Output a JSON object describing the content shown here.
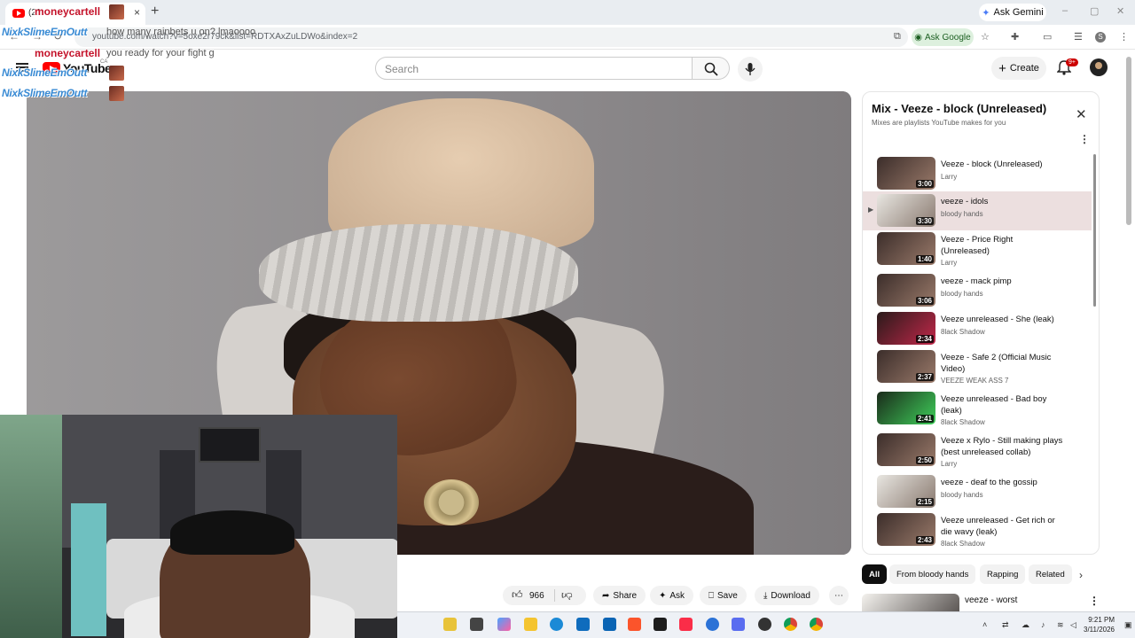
{
  "browser": {
    "tab_count_prefix": "(23",
    "tab_close": "×",
    "new_tab": "+",
    "gemini_label": "Ask Gemini",
    "url": "youtube.com/watch?v=5oxe2r79ck&list=RDTXAxZuLDWo&index=2",
    "ask_google_label": "Ask Google",
    "profile_initial": "S",
    "window_minimize": "–",
    "window_restore": "▢",
    "window_close": "✕"
  },
  "youtube": {
    "logo_text": "YouTube",
    "region": "CA",
    "search_placeholder": "Search",
    "create_label": "Create",
    "notification_badge": "9+"
  },
  "chat": [
    {
      "user": "moneycartell",
      "message": "",
      "color": "red"
    },
    {
      "user": "NixkSlimeEmOutt",
      "message": "how many rainbets u on? lmaoooo",
      "color": "blue"
    },
    {
      "user": "moneycartell",
      "message": "you ready for your fight g",
      "color": "red"
    },
    {
      "user": "NixkSlimeEmOutt",
      "message": "",
      "color": "blue"
    },
    {
      "user": "NixkSlimeEmOutt",
      "message": "",
      "color": "blue"
    }
  ],
  "playlist": {
    "title": "Mix - Veeze - block (Unreleased)",
    "subtitle": "Mixes are playlists YouTube makes for you",
    "items": [
      {
        "title": "Veeze - block (Unreleased)",
        "channel": "Larry",
        "duration": "3:00",
        "active": false
      },
      {
        "title": "veeze - idols",
        "channel": "bloody hands",
        "duration": "3:30",
        "active": true
      },
      {
        "title": "Veeze - Price Right (Unreleased)",
        "channel": "Larry",
        "duration": "1:40",
        "active": false
      },
      {
        "title": "veeze - mack pimp",
        "channel": "bloody hands",
        "duration": "3:06",
        "active": false
      },
      {
        "title": "Veeze unreleased - She (leak)",
        "channel": "8lack Shadow",
        "duration": "2:34",
        "active": false
      },
      {
        "title": "Veeze - Safe 2 (Official Music Video)",
        "channel": "VEEZE WEAK ASS 7",
        "duration": "2:37",
        "active": false
      },
      {
        "title": "Veeze unreleased - Bad boy (leak)",
        "channel": "8lack Shadow",
        "duration": "2:41",
        "active": false
      },
      {
        "title": "Veeze x Rylo - Still making plays (best unreleased collab)",
        "channel": "Larry",
        "duration": "2:50",
        "active": false
      },
      {
        "title": "veeze - deaf to the gossip",
        "channel": "bloody hands",
        "duration": "2:15",
        "active": false
      },
      {
        "title": "Veeze unreleased - Get rich or die wavy (leak)",
        "channel": "8lack Shadow",
        "duration": "2:43",
        "active": false
      }
    ]
  },
  "chips": [
    "All",
    "From bloody hands",
    "Rapping",
    "Related"
  ],
  "actions": {
    "like_count": "966",
    "share": "Share",
    "ask": "Ask",
    "save": "Save",
    "download": "Download"
  },
  "next_video": {
    "title": "veeze - worst"
  },
  "taskbar": {
    "time": "9:21 PM",
    "date": "3/11/2026"
  }
}
